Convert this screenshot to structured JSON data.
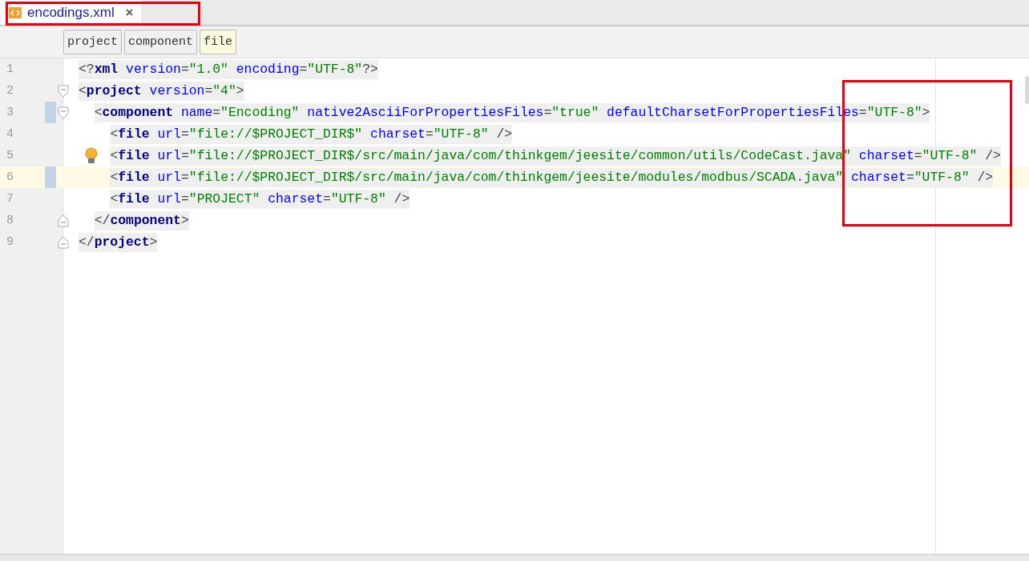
{
  "tab": {
    "title": "encodings.xml",
    "close": "×",
    "selected": true
  },
  "breadcrumbs": [
    {
      "label": "project",
      "selected": false
    },
    {
      "label": "component",
      "selected": false
    },
    {
      "label": "file",
      "selected": true
    }
  ],
  "lines": [
    {
      "number": "1",
      "fold_start": false,
      "fold_end": false,
      "marked": false,
      "current": false,
      "hint": false,
      "tokens": [
        {
          "kind": "p",
          "text": "<?"
        },
        {
          "kind": "t",
          "text": "xml"
        },
        {
          "kind": "a",
          "text": " version"
        },
        {
          "kind": "p",
          "text": "="
        },
        {
          "kind": "v",
          "text": "\"1.0\""
        },
        {
          "kind": "a",
          "text": " encoding"
        },
        {
          "kind": "p",
          "text": "="
        },
        {
          "kind": "v",
          "text": "\"UTF-8\""
        },
        {
          "kind": "p",
          "text": "?>"
        }
      ]
    },
    {
      "number": "2",
      "fold_start": true,
      "fold_end": false,
      "marked": false,
      "current": false,
      "hint": false,
      "tokens": [
        {
          "kind": "p",
          "text": "<"
        },
        {
          "kind": "t",
          "text": "project"
        },
        {
          "kind": "a",
          "text": " version"
        },
        {
          "kind": "p",
          "text": "="
        },
        {
          "kind": "v",
          "text": "\"4\""
        },
        {
          "kind": "p",
          "text": ">"
        }
      ],
      "children": [
        {
          "number": "3",
          "fold_start": true,
          "fold_end": false,
          "marked": true,
          "current": false,
          "hint": false,
          "tokens": [
            {
              "kind": "p",
              "text": "<"
            },
            {
              "kind": "t",
              "text": "component"
            },
            {
              "kind": "a",
              "text": " name"
            },
            {
              "kind": "p",
              "text": "="
            },
            {
              "kind": "v",
              "text": "\"Encoding\""
            },
            {
              "kind": "a",
              "text": " native2AsciiForPropertiesFiles"
            },
            {
              "kind": "p",
              "text": "="
            },
            {
              "kind": "v",
              "text": "\"true\""
            },
            {
              "kind": "a",
              "text": " defaultCharsetForPropertiesFiles"
            },
            {
              "kind": "p",
              "text": "="
            },
            {
              "kind": "v",
              "text": "\"UTF-8\""
            },
            {
              "kind": "p",
              "text": ">"
            }
          ],
          "children": [
            {
              "number": "4",
              "fold_start": false,
              "fold_end": false,
              "marked": false,
              "current": false,
              "hint": false,
              "tokens": [
                {
                  "kind": "p",
                  "text": "<"
                },
                {
                  "kind": "t",
                  "text": "file"
                },
                {
                  "kind": "a",
                  "text": " url"
                },
                {
                  "kind": "p",
                  "text": "="
                },
                {
                  "kind": "v",
                  "text": "\"file://$PROJECT_DIR$\""
                },
                {
                  "kind": "a",
                  "text": " charset"
                },
                {
                  "kind": "p",
                  "text": "="
                },
                {
                  "kind": "v",
                  "text": "\"UTF-8\""
                },
                {
                  "kind": "p",
                  "text": " />"
                }
              ]
            },
            {
              "number": "5",
              "fold_start": false,
              "fold_end": false,
              "marked": false,
              "current": false,
              "hint": true,
              "tokens": [
                {
                  "kind": "p",
                  "text": "<"
                },
                {
                  "kind": "t",
                  "text": "file"
                },
                {
                  "kind": "a",
                  "text": " url"
                },
                {
                  "kind": "p",
                  "text": "="
                },
                {
                  "kind": "v",
                  "text": "\"file://$PROJECT_DIR$/src/main/java/com/thinkgem/jeesite/common/utils/CodeCast.java\""
                },
                {
                  "kind": "a",
                  "text": " charset"
                },
                {
                  "kind": "p",
                  "text": "="
                },
                {
                  "kind": "v",
                  "text": "\"UTF-8\""
                },
                {
                  "kind": "p",
                  "text": " />"
                }
              ]
            },
            {
              "number": "6",
              "fold_start": false,
              "fold_end": false,
              "marked": true,
              "current": true,
              "hint": false,
              "tokens": [
                {
                  "kind": "p",
                  "text": "<"
                },
                {
                  "kind": "t",
                  "text": "file"
                },
                {
                  "kind": "a",
                  "text": " url"
                },
                {
                  "kind": "p",
                  "text": "="
                },
                {
                  "kind": "v",
                  "text": "\"file://$PROJECT_DIR$/src/main/java/com/thinkgem/jeesite/modules/modbus/SCADA.java\""
                },
                {
                  "kind": "a",
                  "text": " charset"
                },
                {
                  "kind": "p",
                  "text": "="
                },
                {
                  "kind": "v",
                  "text": "\"UTF-8\""
                },
                {
                  "kind": "p",
                  "text": " />"
                }
              ]
            },
            {
              "number": "7",
              "fold_start": false,
              "fold_end": false,
              "marked": false,
              "current": false,
              "hint": false,
              "tokens": [
                {
                  "kind": "p",
                  "text": "<"
                },
                {
                  "kind": "t",
                  "text": "file"
                },
                {
                  "kind": "a",
                  "text": " url"
                },
                {
                  "kind": "p",
                  "text": "="
                },
                {
                  "kind": "v",
                  "text": "\"PROJECT\""
                },
                {
                  "kind": "a",
                  "text": " charset"
                },
                {
                  "kind": "p",
                  "text": "="
                },
                {
                  "kind": "v",
                  "text": "\"UTF-8\""
                },
                {
                  "kind": "p",
                  "text": " />"
                }
              ]
            }
          ]
        },
        {
          "number": "8",
          "fold_start": false,
          "fold_end": true,
          "marked": false,
          "current": false,
          "hint": false,
          "tokens": [
            {
              "kind": "p",
              "text": "</"
            },
            {
              "kind": "t",
              "text": "component"
            },
            {
              "kind": "p",
              "text": ">"
            }
          ]
        }
      ]
    },
    {
      "number": "9",
      "fold_start": false,
      "fold_end": true,
      "marked": false,
      "current": false,
      "hint": false,
      "tokens": [
        {
          "kind": "p",
          "text": "</"
        },
        {
          "kind": "t",
          "text": "project"
        },
        {
          "kind": "p",
          "text": ">"
        }
      ]
    }
  ]
}
